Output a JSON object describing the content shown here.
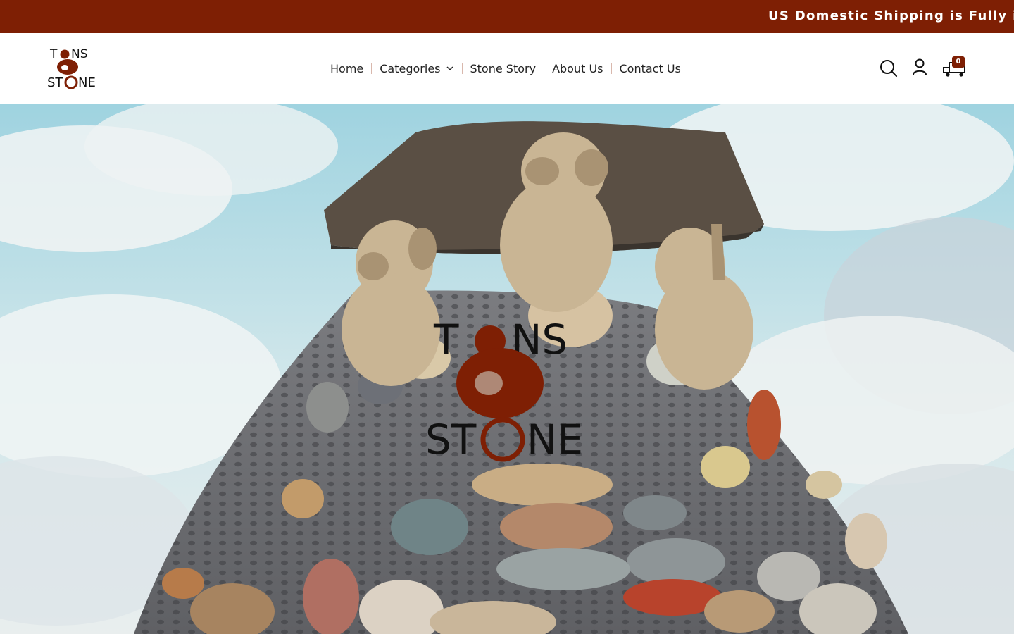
{
  "announcement": {
    "text": "US Domestic Shipping is Fully in"
  },
  "brand": {
    "logo_alt": "Tons of Stone",
    "logo_text_top": "TONS",
    "logo_text_bottom": "STONE",
    "accent_color": "#7e1f04"
  },
  "nav": {
    "items": [
      {
        "label": "Home"
      },
      {
        "label": "Categories",
        "has_dropdown": true
      },
      {
        "label": "Stone Story"
      },
      {
        "label": "About Us"
      },
      {
        "label": "Contact Us"
      }
    ]
  },
  "header_icons": {
    "search": "search-icon",
    "account": "user-icon",
    "cart": "cart-icon",
    "cart_count": "0"
  },
  "hero": {
    "image": "stone-monkey-sculpture-mound",
    "overlay_logo_text_top": "TONS",
    "overlay_logo_text_bottom": "STONE"
  }
}
